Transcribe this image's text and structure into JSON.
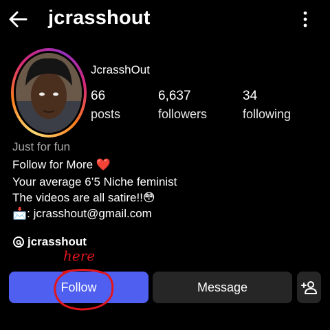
{
  "header": {
    "username": "jcrasshout"
  },
  "profile": {
    "display_name": "JcrasshOut",
    "stats": [
      {
        "value": "66",
        "label": "posts"
      },
      {
        "value": "6,637",
        "label": "followers"
      },
      {
        "value": "34",
        "label": "following"
      }
    ],
    "category": "Just for fun",
    "bio": [
      "Follow for More ❤️",
      "Your average 6’5 Niche feminist",
      "The videos are all satire!!😳",
      "📩: jcrasshout@gmail.com"
    ],
    "threads_handle": "jcrasshout"
  },
  "actions": {
    "follow_label": "Follow",
    "message_label": "Message"
  },
  "annotation": {
    "text": "here"
  },
  "colors": {
    "follow": "#4f5ff0",
    "secondary_button": "#262626",
    "annotation": "#e0161c"
  }
}
